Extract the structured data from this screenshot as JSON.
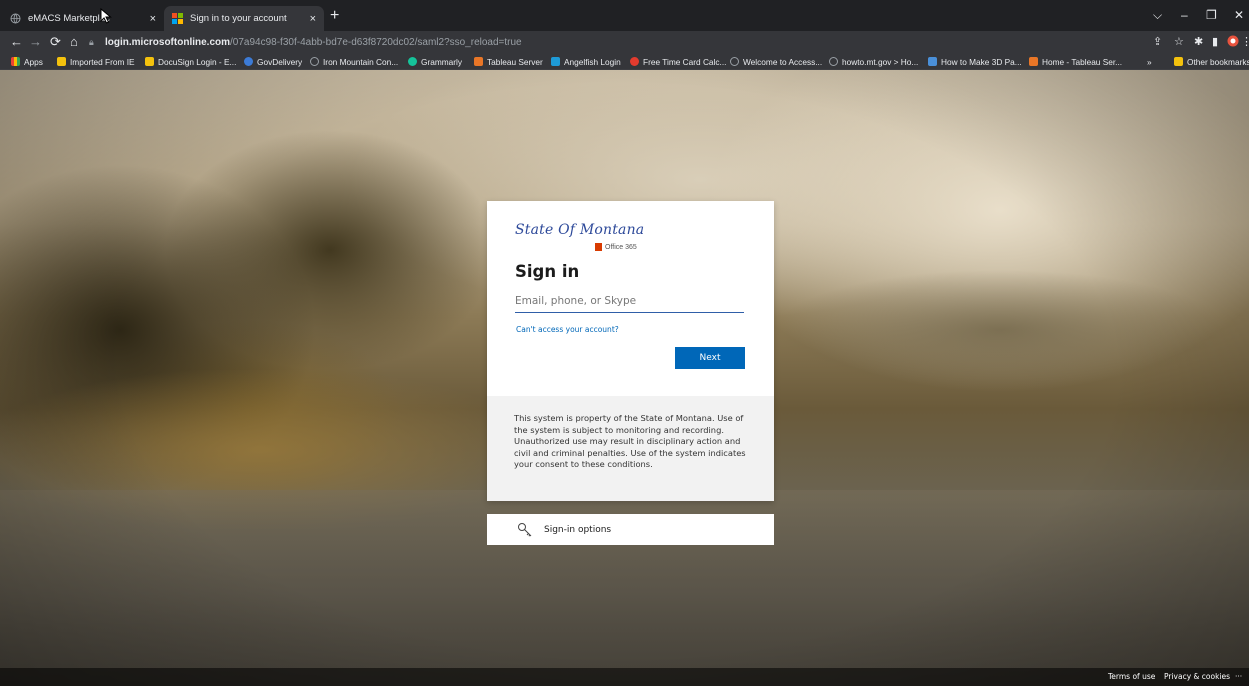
{
  "tabs": [
    {
      "title": "eMACS Marketplac",
      "close": "×"
    },
    {
      "title": "Sign in to your account",
      "close": "×"
    }
  ],
  "new_tab_label": "+",
  "window_controls": {
    "dropdown": "⌵",
    "minimize": "–",
    "restore": "❐",
    "close": "✕"
  },
  "address_bar": {
    "host": "login.microsoftonline.com",
    "path": "/07a94c98-f30f-4abb-bd7e-d63f8720dc02/saml2?sso_reload=true"
  },
  "bookmarks": [
    {
      "label": "Apps",
      "color": "#4285f4"
    },
    {
      "label": "Imported From IE",
      "color": "#f4c20d"
    },
    {
      "label": "DocuSign Login - E...",
      "color": "#f4c20d"
    },
    {
      "label": "GovDelivery",
      "color": "#3c7bd6"
    },
    {
      "label": "Iron Mountain Con...",
      "color": "#9aa0a6"
    },
    {
      "label": "Grammarly",
      "color": "#15c39a"
    },
    {
      "label": "Tableau Server",
      "color": "#e97627"
    },
    {
      "label": "Angelfish Login",
      "color": "#1e9bd7"
    },
    {
      "label": "Free Time Card Calc...",
      "color": "#e33b2e"
    },
    {
      "label": "Welcome to Access...",
      "color": "#9aa0a6"
    },
    {
      "label": "howto.mt.gov > Ho...",
      "color": "#9aa0a6"
    },
    {
      "label": "How to Make 3D Pa...",
      "color": "#4a90d9"
    },
    {
      "label": "Home - Tableau Ser...",
      "color": "#e97627"
    }
  ],
  "bookmarks_more": "»",
  "other_bookmarks": "Other bookmarks",
  "signin": {
    "logo_text": "State Of Montana",
    "logo_sub": "Office 365",
    "title": "Sign in",
    "email_placeholder": "Email, phone, or Skype",
    "email_value": "",
    "cant_access": "Can't access your account?",
    "next_label": "Next",
    "notice": "This system is property of the State of Montana. Use of the system is subject to monitoring and recording. Unauthorized use may result in disciplinary action and civil and criminal penalties. Use of the system indicates your consent to these conditions."
  },
  "signin_options": {
    "label": "Sign-in options",
    "icon": "key-icon"
  },
  "footer": {
    "terms": "Terms of use",
    "privacy": "Privacy & cookies",
    "more": "···"
  },
  "colors": {
    "accent": "#0067b8",
    "chrome_dark": "#202124",
    "chrome": "#35363a"
  }
}
